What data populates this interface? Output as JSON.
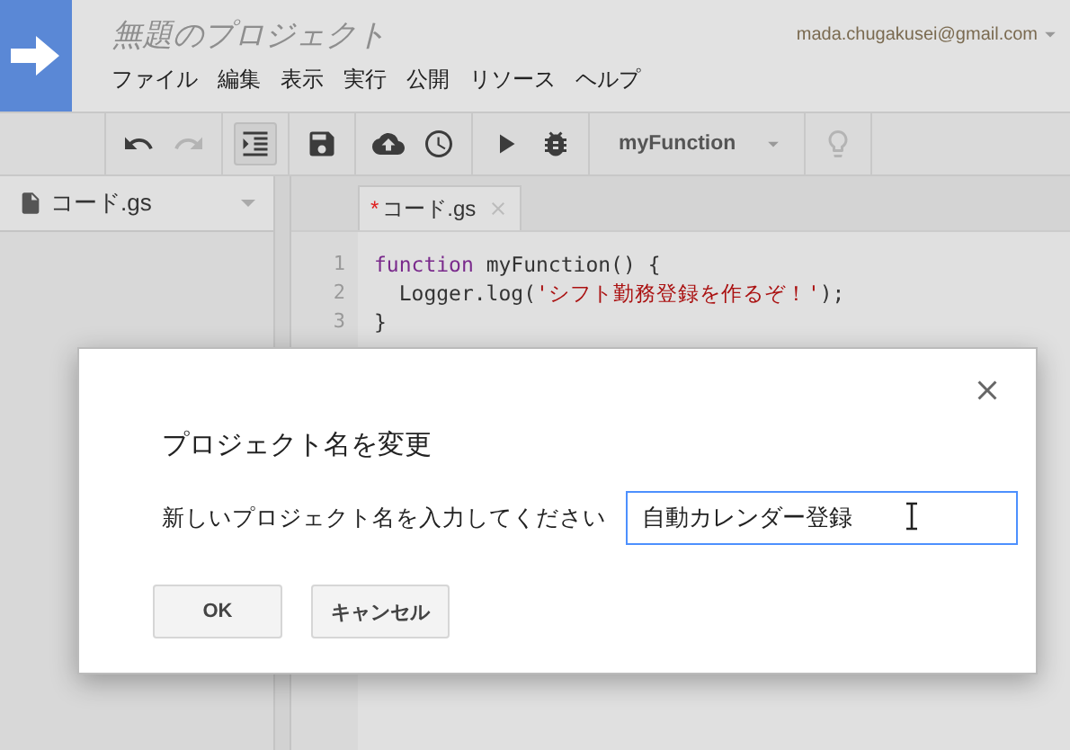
{
  "header": {
    "title": "無題のプロジェクト",
    "email": "mada.chugakusei@gmail.com"
  },
  "menu": [
    "ファイル",
    "編集",
    "表示",
    "実行",
    "公開",
    "リソース",
    "ヘルプ"
  ],
  "toolbar": {
    "groups": [
      [
        {
          "kind": "undo",
          "disabled": false
        },
        {
          "kind": "redo",
          "disabled": true
        }
      ],
      [
        {
          "kind": "indent",
          "pressed": true
        }
      ],
      [
        {
          "kind": "save",
          "disabled": false
        }
      ],
      [
        {
          "kind": "upload",
          "disabled": false
        },
        {
          "kind": "triggers",
          "disabled": false
        }
      ],
      [
        {
          "kind": "run",
          "disabled": false
        },
        {
          "kind": "debug",
          "disabled": false
        }
      ],
      [
        {
          "kind": "select",
          "label": "myFunction"
        }
      ],
      [
        {
          "kind": "hint",
          "disabled": true
        }
      ]
    ]
  },
  "sidebar": {
    "file": "コード.gs"
  },
  "editor": {
    "tabs": [
      {
        "label": "コード.gs",
        "modified": true,
        "marker": "*",
        "selected": true
      }
    ],
    "lines": [
      {
        "number": "1",
        "tokens": [
          {
            "kind": "keyword",
            "text": "function"
          },
          {
            "kind": "plain",
            "text": " myFunction() {"
          }
        ]
      },
      {
        "number": "2",
        "tokens": [
          {
            "kind": "plain",
            "text": "  Logger.log("
          },
          {
            "kind": "string",
            "text": "'シフト勤務登録を作るぞ！'"
          },
          {
            "kind": "plain",
            "text": ");"
          }
        ]
      },
      {
        "number": "3",
        "tokens": [
          {
            "kind": "plain",
            "text": "}"
          }
        ]
      }
    ]
  },
  "dialog": {
    "title": "プロジェクト名を変更",
    "label": "新しいプロジェクト名を入力してください",
    "value": "自動カレンダー登録",
    "buttons": [
      "OK",
      "キャンセル"
    ]
  }
}
